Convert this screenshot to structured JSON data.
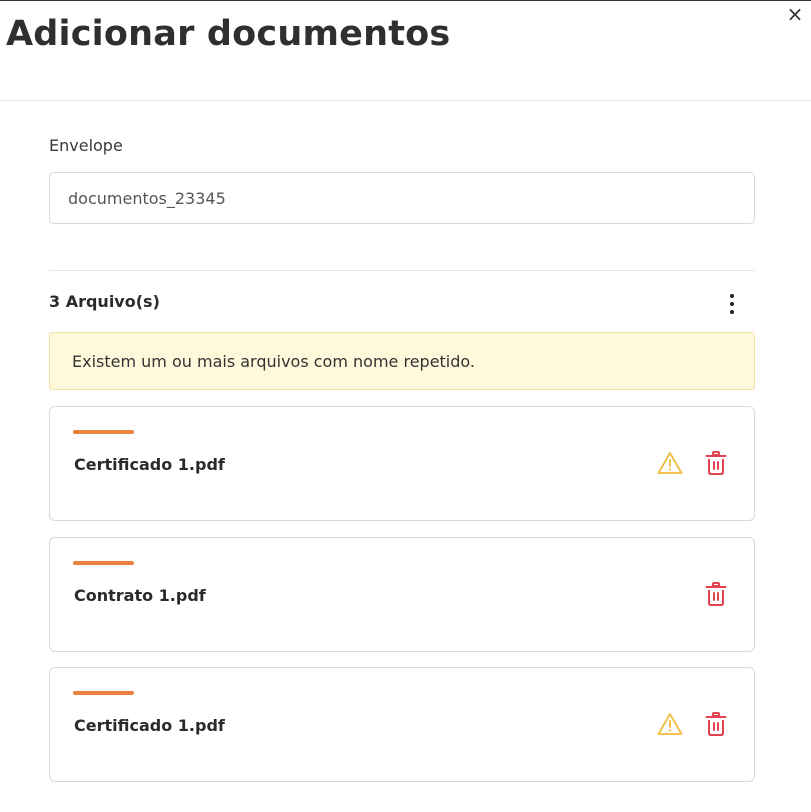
{
  "modal": {
    "title": "Adicionar documentos",
    "close_glyph": "×"
  },
  "envelope": {
    "label": "Envelope",
    "value": "documentos_23345"
  },
  "files": {
    "count_label": "3 Arquivo(s)",
    "warning_text": "Existem um ou mais arquivos com nome repetido.",
    "items": [
      {
        "name": "Certificado 1.pdf",
        "duplicate_warning": true
      },
      {
        "name": "Contrato 1.pdf",
        "duplicate_warning": false
      },
      {
        "name": "Certificado 1.pdf",
        "duplicate_warning": true
      }
    ]
  },
  "icons": {
    "menu": "more-vertical-icon",
    "warning": "warning-triangle-icon",
    "delete": "trash-icon",
    "close": "close-icon"
  },
  "colors": {
    "accent": "#e8823e",
    "warning_icon": "#f0c14b",
    "delete_icon": "#e0434f",
    "banner_bg": "#fff8db"
  }
}
